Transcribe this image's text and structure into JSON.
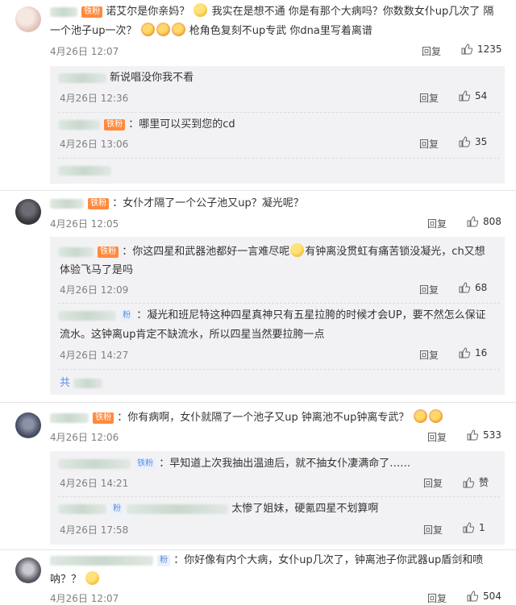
{
  "comments": [
    {
      "text": "诺艾尔是你亲妈？",
      "text2": "我实在是想不通 你是有那个大病吗？你数数女仆up几次了 隔",
      "text3_a": "一个池子up一次？",
      "text3_b": "枪角色复刻不up专武 你dna里写着离谱",
      "badge": "铁粉",
      "date": "4月26日 12:07",
      "reply": "回复",
      "likes": "1235",
      "replies": [
        {
          "text": "新说唱没你我不看",
          "date": "4月26日 12:36",
          "reply": "回复",
          "likes": "54"
        },
        {
          "text": "：哪里可以买到您的cd",
          "badge": "铁粉",
          "date": "4月26日 13:06",
          "reply": "回复",
          "likes": "35"
        }
      ]
    },
    {
      "text": "：女仆才隔了一个公子池又up？凝光呢？",
      "badge": "铁粉",
      "date": "4月26日 12:05",
      "reply": "回复",
      "likes": "808",
      "replies": [
        {
          "text_a": "：你这四星和武器池都好一言难尽呢",
          "text_b": "有钟离没贯虹有痛苦锁没凝光，ch又想",
          "text2": "体验飞马了是吗",
          "badge": "铁粉",
          "date": "4月26日 12:09",
          "reply": "回复",
          "likes": "68"
        },
        {
          "text": "：凝光和班尼特这种四星真神只有五星拉胯的时候才会UP，要不然怎么保证",
          "text2": "流水。这钟离up肯定不缺流水，所以四星当然要拉胯一点",
          "badge": "粉",
          "date": "4月26日 14:27",
          "reply": "回复",
          "likes": "16"
        },
        {
          "text": "共"
        }
      ]
    },
    {
      "text": "：你有病啊，女仆就隔了一个池子又up 钟离池不up钟离专武？",
      "badge": "铁粉",
      "date": "4月26日 12:06",
      "reply": "回复",
      "likes": "533",
      "replies": [
        {
          "text": "：早知道上次我抽出温迪后，就不抽女仆凄满命了……",
          "badge": "铁粉",
          "date": "4月26日 14:21",
          "reply": "回复",
          "likes": "赞"
        },
        {
          "text": "太惨了姐妹，硬氪四星不划算啊",
          "badge": "粉",
          "date": "4月26日 17:58",
          "reply": "回复",
          "likes": "1"
        }
      ]
    },
    {
      "text": "：你好像有内个大病，女仆up几次了，钟离池子你武器up盾剑和喷",
      "text2": "呐？？",
      "badge": "粉",
      "date": "4月26日 12:07",
      "reply": "回复",
      "likes": "504"
    }
  ],
  "icons": {
    "like": "thumbs-up-icon",
    "emoji": "grin-emoji-icon"
  },
  "colors": {
    "badge_orange": "#ff8a3d",
    "link_blue": "#5b8de0",
    "subbox": "#f2f2f5"
  }
}
